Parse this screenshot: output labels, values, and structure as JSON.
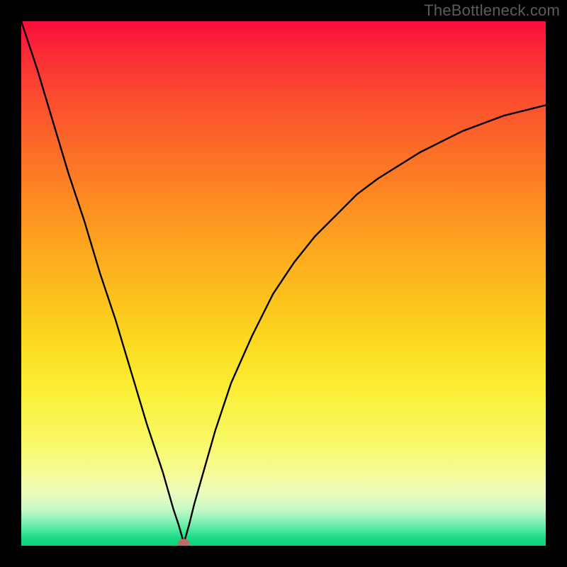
{
  "watermark": "TheBottleneck.com",
  "chart_data": {
    "type": "line",
    "title": "",
    "xlabel": "",
    "ylabel": "",
    "xlim": [
      0,
      100
    ],
    "ylim": [
      0,
      100
    ],
    "grid": false,
    "legend": false,
    "marker": {
      "x": 31,
      "y": 99.5
    },
    "series": [
      {
        "name": "bottleneck-curve",
        "x": [
          0,
          3,
          6,
          9,
          12,
          15,
          18,
          21,
          24,
          27,
          29,
          30,
          31,
          32,
          33,
          35,
          37,
          40,
          44,
          48,
          52,
          56,
          60,
          64,
          68,
          72,
          76,
          80,
          84,
          88,
          92,
          96,
          100
        ],
        "y": [
          0,
          9,
          19,
          29,
          38,
          48,
          57,
          67,
          77,
          86,
          93,
          96,
          99.5,
          96,
          92,
          85,
          78,
          69,
          60,
          52,
          46,
          41,
          37,
          33,
          30,
          27.5,
          25,
          23,
          21,
          19.5,
          18,
          17,
          16
        ]
      }
    ],
    "gradient": {
      "top_color": "#f80d3a",
      "mid_color": "#fbdc21",
      "bottom_color": "#09d47c"
    }
  }
}
